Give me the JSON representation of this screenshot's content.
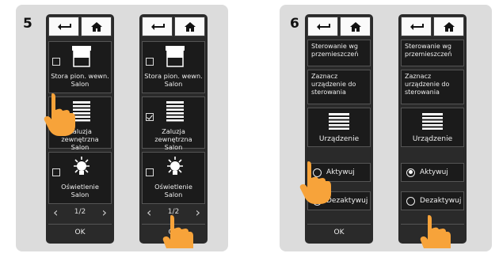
{
  "left_panel": {
    "step": "5",
    "items": [
      {
        "label_1": "Stora pion. wewn.",
        "label_2": "Salon",
        "checked": false
      },
      {
        "label_1": "Zaluzja zewnętrzna",
        "label_2": "Salon",
        "checked": true
      },
      {
        "label_1": "Oświetlenie",
        "label_2": "Salon",
        "checked": false
      }
    ],
    "page_indicator": "1/2",
    "ok_label": "OK"
  },
  "right_panel": {
    "step": "6",
    "mode_title": "Sterowanie wg przemieszczeń",
    "select_prompt": "Zaznacz urządzenie do sterowania",
    "device_label": "Urządzenie",
    "activate_label": "Aktywuj",
    "deactivate_label": "Dezaktywuj",
    "ok_label": "OK"
  },
  "colors": {
    "screen": "#1b1b1b",
    "panel_bg": "#dcdcdc",
    "hand": "#f7a33a"
  }
}
